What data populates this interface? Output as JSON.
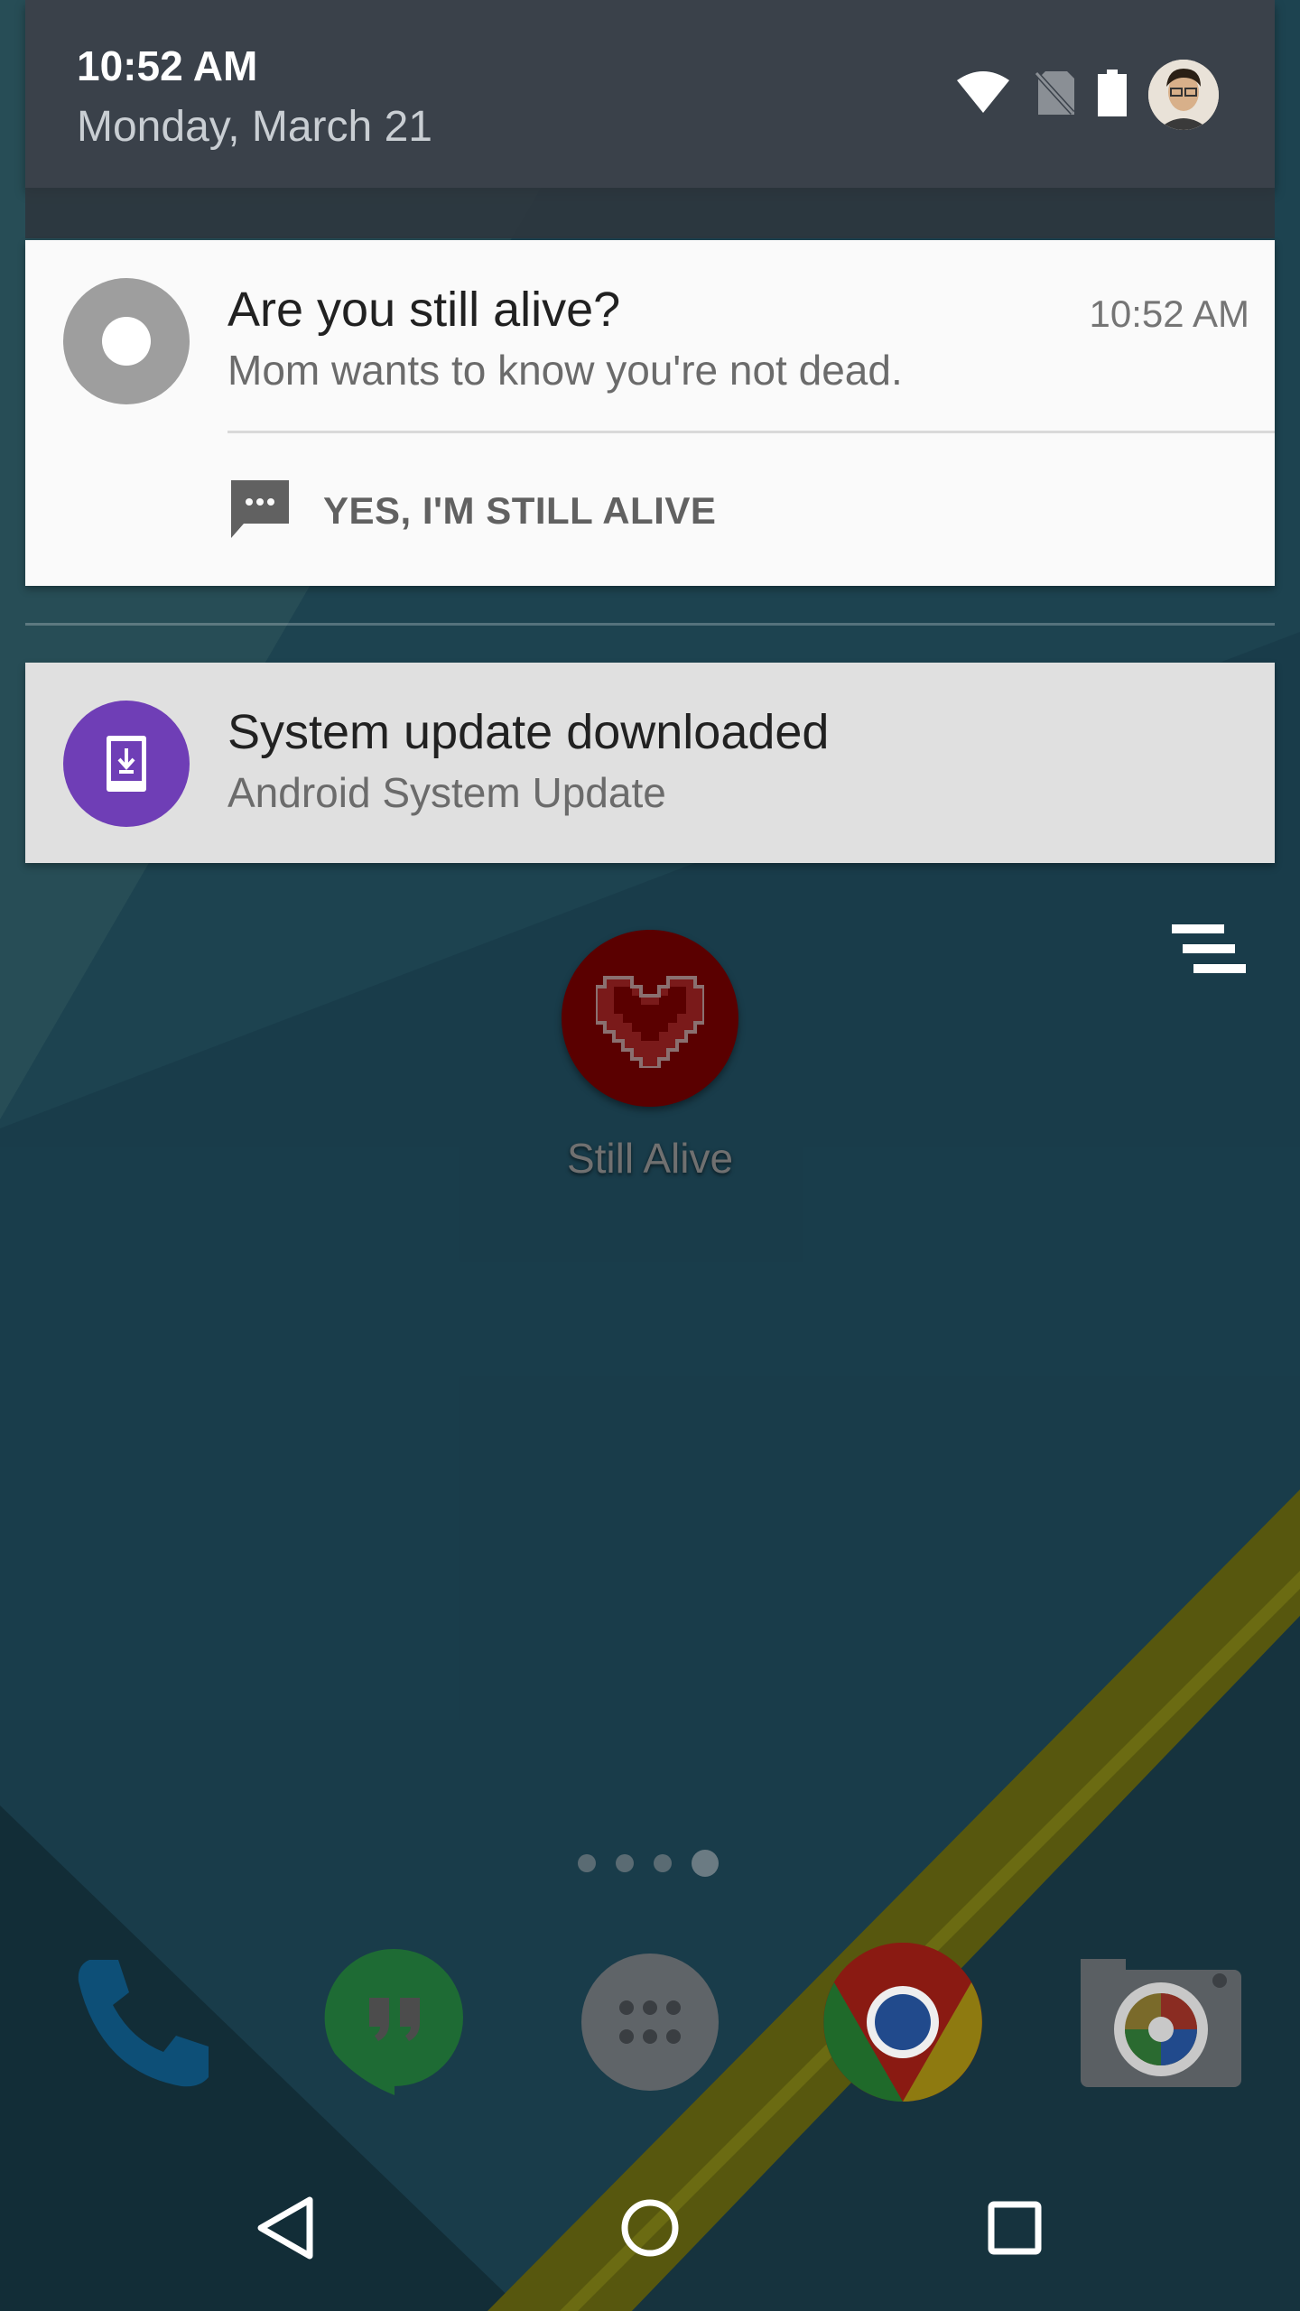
{
  "status_header": {
    "time": "10:52 AM",
    "date": "Monday, March 21",
    "icons": [
      "wifi-icon",
      "no-sim-icon",
      "battery-icon",
      "user-avatar"
    ]
  },
  "notifications": [
    {
      "app_icon": "still-alive-icon",
      "title": "Are you still alive?",
      "text": "Mom wants to know you're not dead.",
      "time": "10:52 AM",
      "action": {
        "icon": "message-icon",
        "label": "YES, I'M STILL ALIVE"
      }
    },
    {
      "app_icon": "system-update-icon",
      "title": "System update downloaded",
      "text": "Android System Update"
    }
  ],
  "home": {
    "app": {
      "icon": "pixel-heart-icon",
      "label": "Still Alive"
    },
    "page_count": 4,
    "active_page": 4,
    "dock": [
      "phone-icon",
      "hangouts-icon",
      "app-drawer-icon",
      "chrome-icon",
      "camera-icon"
    ]
  },
  "nav": [
    "back-button",
    "home-button",
    "recents-button"
  ],
  "colors": {
    "header_bg": "#3a414a",
    "card_bg": "#fafafa",
    "update_card_bg": "#e0e0e0",
    "update_icon_bg": "#6f3eb6",
    "heart_bg": "#5a0000"
  }
}
